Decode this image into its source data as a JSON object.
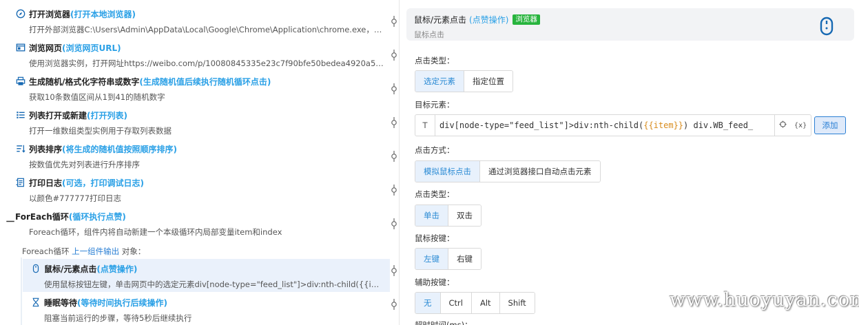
{
  "steps": [
    {
      "name": "打开浏览器",
      "hint": "(打开本地浏览器)",
      "desc": "打开外部浏览器C:\\Users\\Admin\\AppData\\Local\\Google\\Chrome\\Application\\chrome.exe，设…",
      "icon": "compass-icon"
    },
    {
      "name": "浏览网页",
      "hint": "(浏览网页URL)",
      "desc": "使用浏览器实例，打开网址https://weibo.com/p/10080845335e23c7f90bfe50bedea4920a5940…",
      "icon": "browser-window-icon"
    },
    {
      "name": "生成随机/格式化字符串或数字",
      "hint": "(生成随机值后续执行随机循环点击)",
      "desc": "获取10条数值区间从1到41的随机数字",
      "icon": "printer-icon"
    },
    {
      "name": "列表打开或新建",
      "hint": "(打开列表)",
      "desc": "打开一维数组类型实例用于存取列表数据",
      "icon": "list-icon"
    },
    {
      "name": "列表排序",
      "hint": "(将生成的随机值按照顺序排序)",
      "desc": "按数值优先对列表进行升序排序",
      "icon": "sort-list-icon"
    },
    {
      "name": "打印日志",
      "hint": "(可选，打印调试日志)",
      "desc": "以颜色#777777打印日志",
      "icon": "log-icon"
    },
    {
      "name": "ForEach循环",
      "hint": " (循环执行点赞)",
      "desc": "Foreach循环，组件内将自动新建一个本级循环内局部变量item和index",
      "icon": ""
    },
    {
      "name": "鼠标/元素点击",
      "hint": "(点赞操作)",
      "desc": "使用鼠标按钮左键，单击网页中的选定元素div[node-type=\"feed_list\"]>div:nth-child({{item}}…",
      "icon": "mouse-icon"
    },
    {
      "name": "睡眠等待",
      "hint": "(等待时间执行后续操作)",
      "desc": "阻塞当前运行的步骤，等待5秒后继续执行",
      "icon": "hourglass-icon"
    }
  ],
  "loop": {
    "mark": "一",
    "caption_prefix": "Foreach循环 ",
    "caption_link": "上一组件输出",
    "caption_suffix": " 对象："
  },
  "panel": {
    "title": "鼠标/元素点击",
    "hint": "(点赞操作)",
    "badge": "浏览器",
    "subtitle": "鼠标点击",
    "click_type_label": "点击类型：",
    "click_type_options": [
      "选定元素",
      "指定位置"
    ],
    "target_label": "目标元素：",
    "target_type": "T",
    "target_value_prefix": "div[node-type=\"feed_list\"]>div:nth-child(",
    "target_value_var": "{{item}}",
    "target_value_suffix": ") div.WB_feed_",
    "target_var_btn": "{x}",
    "add_button": "添加",
    "click_method_label": "点击方式：",
    "click_method_options": [
      "模拟鼠标点击",
      "通过浏览器接口自动点击元素"
    ],
    "click_kind_label": "点击类型：",
    "click_kind_options": [
      "单击",
      "双击"
    ],
    "mouse_button_label": "鼠标按键：",
    "mouse_button_options": [
      "左键",
      "右键"
    ],
    "modifier_label": "辅助按键：",
    "modifier_options": [
      "无",
      "Ctrl",
      "Alt",
      "Shift"
    ],
    "timeout_label": "超时时间(ms)："
  },
  "watermark": "www.huoyuyan.com"
}
